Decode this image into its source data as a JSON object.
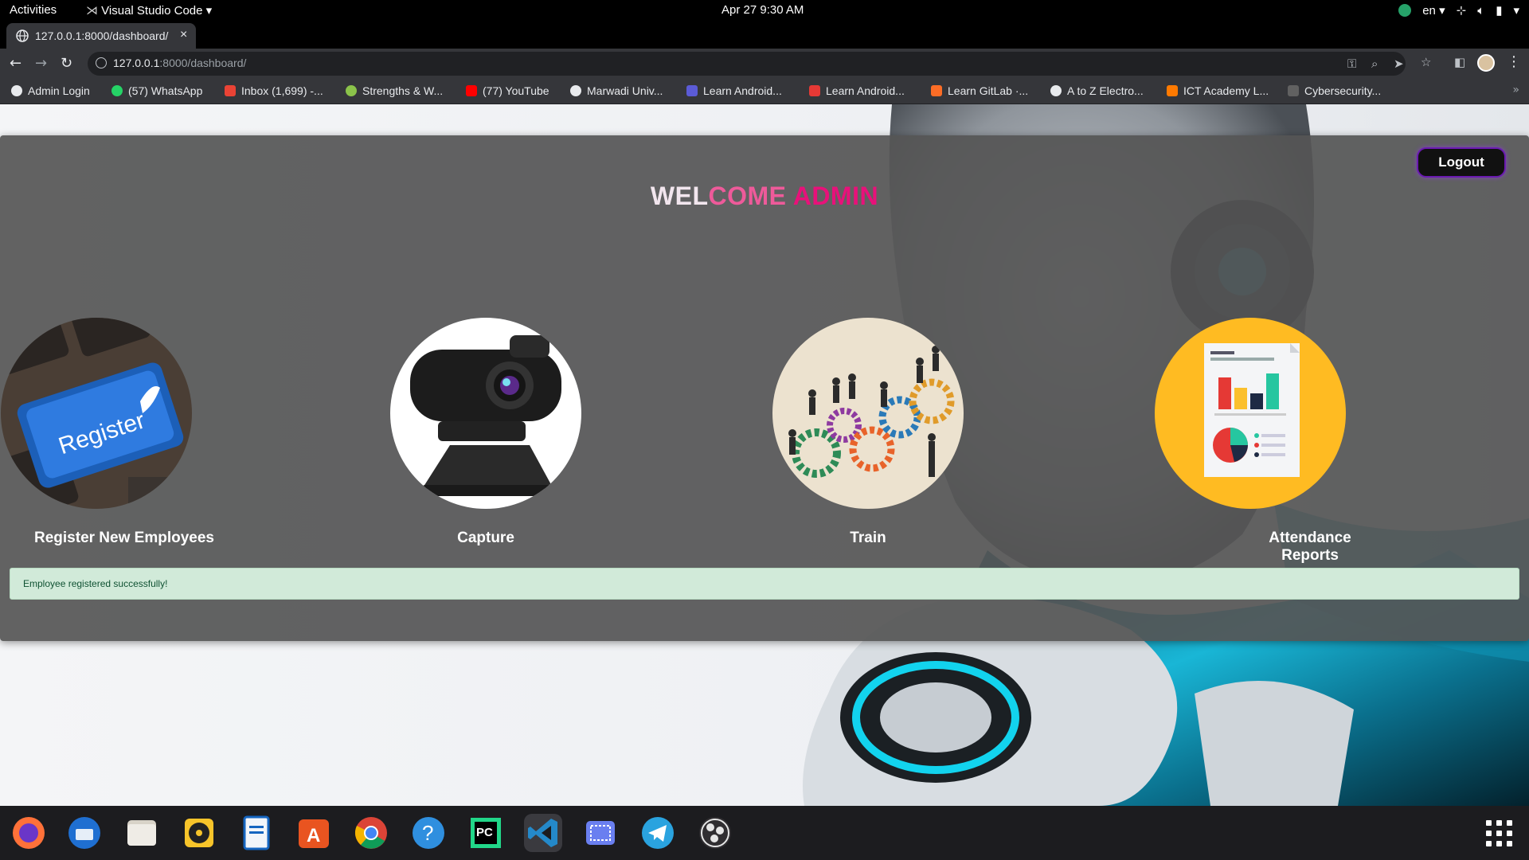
{
  "topbar": {
    "activities": "Activities",
    "app_name": "Visual Studio Code",
    "clock": "Apr 27  9:30 AM",
    "language": "en"
  },
  "browser": {
    "tab_title": "127.0.0.1:8000/dashboard/",
    "url_host": "127.0.0.1",
    "url_path": ":8000/dashboard/",
    "bookmarks": [
      {
        "label": "Admin Login",
        "icon": "globe-icon",
        "color": "#e8eaed"
      },
      {
        "label": "(57) WhatsApp",
        "icon": "whatsapp-icon",
        "color": "#25d366"
      },
      {
        "label": "Inbox (1,699) -...",
        "icon": "gmail-icon",
        "color": "#ea4335"
      },
      {
        "label": "Strengths & W...",
        "icon": "strengths-icon",
        "color": "#8bc34a"
      },
      {
        "label": "(77) YouTube",
        "icon": "youtube-icon",
        "color": "#ff0000"
      },
      {
        "label": "Marwadi Univ...",
        "icon": "globe-icon",
        "color": "#e8eaed"
      },
      {
        "label": "Learn Android...",
        "icon": "grid-icon",
        "color": "#5b5bd6"
      },
      {
        "label": "Learn Android...",
        "icon": "v-icon",
        "color": "#e53935"
      },
      {
        "label": "Learn GitLab ·...",
        "icon": "gitlab-icon",
        "color": "#fc6d26"
      },
      {
        "label": "A to Z Electro...",
        "icon": "globe-icon",
        "color": "#e8eaed"
      },
      {
        "label": "ICT Academy L...",
        "icon": "ict-icon",
        "color": "#ff7a00"
      },
      {
        "label": "Cybersecurity...",
        "icon": "cyber-icon",
        "color": "#9e9e9e"
      }
    ]
  },
  "page": {
    "logout": "Logout",
    "welcome_1": "WEL",
    "welcome_2": "COME ",
    "welcome_3": "ADMIN",
    "cards": [
      {
        "label": "Register New Employees",
        "image": "register-keyboard"
      },
      {
        "label": "Capture",
        "image": "webcam"
      },
      {
        "label": "Train",
        "image": "gears-people"
      },
      {
        "label": "Attendance Reports",
        "image": "report-document"
      }
    ],
    "alert": "Employee registered successfully!"
  },
  "dock": {
    "apps": [
      "firefox-icon",
      "thunderbird-icon",
      "files-icon",
      "rhythmbox-icon",
      "libreoffice-writer-icon",
      "software-icon",
      "chrome-icon",
      "help-icon",
      "pycharm-icon",
      "vscode-icon",
      "screenshot-icon",
      "telegram-icon",
      "obs-icon"
    ]
  },
  "colors": {
    "panel": "#555555",
    "welcome_pink": "#ee5a9a",
    "welcome_magenta": "#e8117a",
    "alert_bg": "#d1ead9",
    "alert_text": "#0f5132"
  }
}
